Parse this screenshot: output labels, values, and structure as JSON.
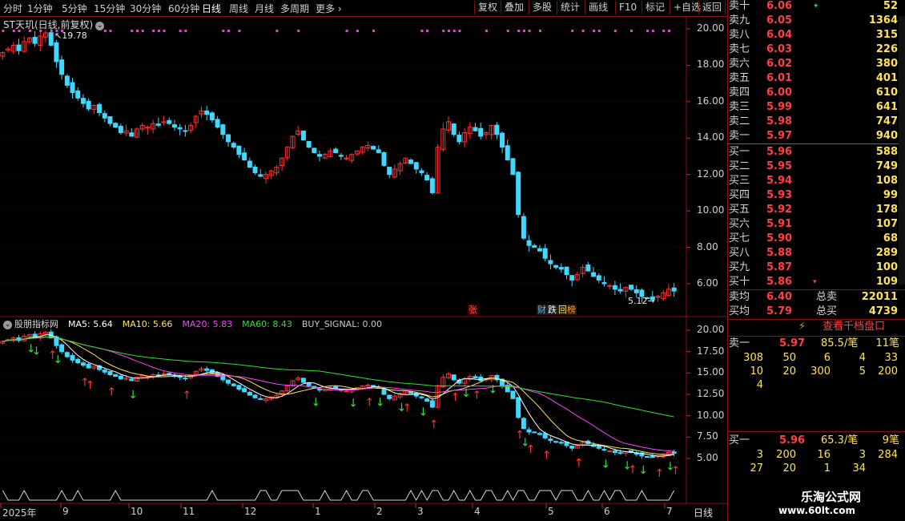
{
  "toolbar": {
    "period_tabs": [
      "分时",
      "1分钟",
      "5分钟",
      "15分钟",
      "30分钟",
      "60分钟",
      "日线",
      "周线",
      "月线",
      "多周期",
      "更多"
    ],
    "active_period": "日线",
    "buttons": [
      "复权",
      "叠加",
      "多股",
      "统计",
      "画线",
      "F10",
      "标记",
      "+自选",
      "返回"
    ]
  },
  "main_chart": {
    "title": "ST天玑(日线,前复权)",
    "high_label": "19.78",
    "low_label": "5.12",
    "y_ticks": [
      "20.00",
      "18.00",
      "16.00",
      "14.00",
      "12.00",
      "10.00",
      "8.00",
      "6.00"
    ],
    "news_badges": [
      {
        "text": "张",
        "color": "#ff5050"
      },
      {
        "text": "财",
        "color": "#40c8ff"
      },
      {
        "text": "跌",
        "color": "#ffffff"
      },
      {
        "text": "回",
        "color": "#ffe25a"
      },
      {
        "text": "榜",
        "color": "#ff9a30"
      }
    ]
  },
  "indicator": {
    "name": "股朋指标网",
    "items": [
      {
        "label": "MA5: 5.64",
        "color": "#ffffff"
      },
      {
        "label": "MA10: 5.66",
        "color": "#ffe25a"
      },
      {
        "label": "MA20: 5.83",
        "color": "#ff40ff"
      },
      {
        "label": "MA60: 8.43",
        "color": "#30e030"
      },
      {
        "label": "BUY_SIGNAL: 0.00",
        "color": "#c8c8c8"
      }
    ],
    "y_ticks": [
      "20.00",
      "17.50",
      "15.00",
      "12.50",
      "10.00",
      "7.50",
      "5.00"
    ]
  },
  "x_axis": {
    "labels": [
      "2025年",
      "9",
      "10",
      "11",
      "12",
      "1",
      "2",
      "3",
      "4",
      "5",
      "6",
      "7"
    ],
    "period_label": "日线"
  },
  "chart_data": {
    "type": "candlestick",
    "x_start": "2025年8月",
    "x_end": "2026年7月",
    "ylim": [
      4.5,
      20.5
    ],
    "closes": [
      18.7,
      18.9,
      19.1,
      18.8,
      19.3,
      19.5,
      19.2,
      19.6,
      19.78,
      19.1,
      18.2,
      17.5,
      16.9,
      16.5,
      16.2,
      15.9,
      15.6,
      15.8,
      15.4,
      15.1,
      14.8,
      14.6,
      14.3,
      14.4,
      14.1,
      14.5,
      14.7,
      14.6,
      14.8,
      14.7,
      14.9,
      14.8,
      14.6,
      14.5,
      14.4,
      14.7,
      15.2,
      15.5,
      15.3,
      15.0,
      14.6,
      14.2,
      13.8,
      13.5,
      13.1,
      12.8,
      12.4,
      12.1,
      11.9,
      12.0,
      12.2,
      12.4,
      12.9,
      13.5,
      14.1,
      14.4,
      13.9,
      13.5,
      13.2,
      13.0,
      13.1,
      13.3,
      13.2,
      13.0,
      12.9,
      13.1,
      13.3,
      13.5,
      13.6,
      13.4,
      13.2,
      12.5,
      12.0,
      12.3,
      12.6,
      12.9,
      12.6,
      12.3,
      12.1,
      11.7,
      11.0,
      13.5,
      14.5,
      14.9,
      14.2,
      13.8,
      14.3,
      14.6,
      14.4,
      14.1,
      14.3,
      14.7,
      14.2,
      13.5,
      12.8,
      12.0,
      9.8,
      8.5,
      8.1,
      8.0,
      7.8,
      7.4,
      7.1,
      6.9,
      6.8,
      6.5,
      6.2,
      6.5,
      6.9,
      6.7,
      6.4,
      6.2,
      6.0,
      5.9,
      5.7,
      5.6,
      5.8,
      5.7,
      5.5,
      5.3,
      5.2,
      5.12,
      5.3,
      5.5,
      5.7,
      5.6
    ],
    "order_book": {
      "asks": [
        {
          "level": "卖十",
          "price": "6.06",
          "volume": "52"
        },
        {
          "level": "卖九",
          "price": "6.05",
          "volume": "1364"
        },
        {
          "level": "卖八",
          "price": "6.04",
          "volume": "315"
        },
        {
          "level": "卖七",
          "price": "6.03",
          "volume": "226"
        },
        {
          "level": "卖六",
          "price": "6.02",
          "volume": "380"
        },
        {
          "level": "卖五",
          "price": "6.01",
          "volume": "401"
        },
        {
          "level": "卖四",
          "price": "6.00",
          "volume": "610"
        },
        {
          "level": "卖三",
          "price": "5.99",
          "volume": "641"
        },
        {
          "level": "卖二",
          "price": "5.98",
          "volume": "747"
        },
        {
          "level": "卖一",
          "price": "5.97",
          "volume": "940"
        }
      ],
      "bids": [
        {
          "level": "买一",
          "price": "5.96",
          "volume": "588"
        },
        {
          "level": "买二",
          "price": "5.95",
          "volume": "749"
        },
        {
          "level": "买三",
          "price": "5.94",
          "volume": "108"
        },
        {
          "level": "买四",
          "price": "5.93",
          "volume": "99"
        },
        {
          "level": "买五",
          "price": "5.92",
          "volume": "178"
        },
        {
          "level": "买六",
          "price": "5.91",
          "volume": "107"
        },
        {
          "level": "买七",
          "price": "5.90",
          "volume": "68"
        },
        {
          "level": "买八",
          "price": "5.88",
          "volume": "289"
        },
        {
          "level": "买九",
          "price": "5.87",
          "volume": "100"
        },
        {
          "level": "买十",
          "price": "5.86",
          "volume": "109"
        }
      ]
    }
  },
  "panel": {
    "ask_avg": {
      "label": "卖均",
      "price": "6.40",
      "total_label": "总卖",
      "total": "22011"
    },
    "bid_avg": {
      "label": "买均",
      "price": "5.79",
      "total_label": "总买",
      "total": "4739"
    },
    "queue_button": "查看千档盘口",
    "sell_queue": {
      "label": "卖一",
      "price": "5.97",
      "per": "85.5/笔",
      "count": "11笔",
      "rows": [
        [
          "308",
          "50",
          "6",
          "4",
          "33"
        ],
        [
          "10",
          "20",
          "300",
          "5",
          "200"
        ],
        [
          "4",
          "",
          "",
          "",
          ""
        ]
      ]
    },
    "buy_queue": {
      "label": "买一",
      "price": "5.96",
      "per": "65.3/笔",
      "count": "9笔",
      "rows": [
        [
          "3",
          "200",
          "16",
          "3",
          "284"
        ],
        [
          "27",
          "20",
          "1",
          "34",
          ""
        ]
      ]
    }
  },
  "watermark": {
    "line1": "乐淘公式网",
    "line2": "www.60lt.com"
  }
}
